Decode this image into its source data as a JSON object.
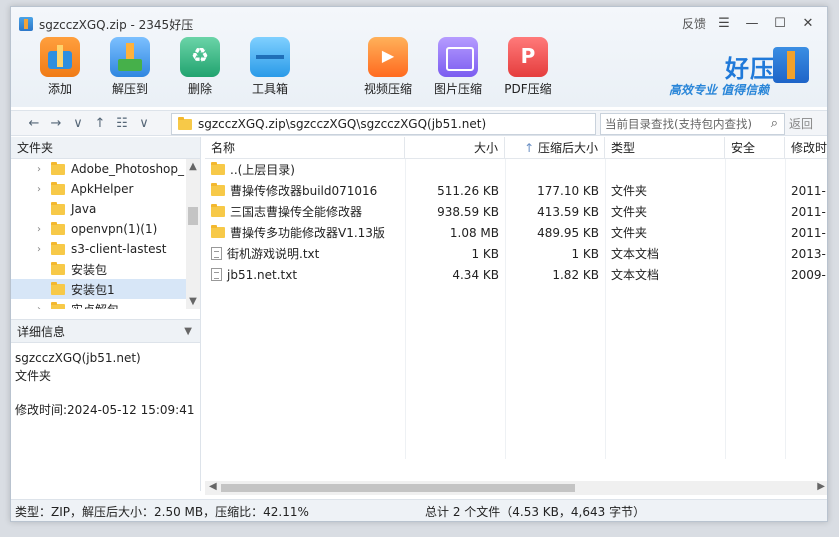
{
  "window": {
    "title": "sgzcczXGQ.zip - 2345好压",
    "feedback": "反馈"
  },
  "toolbar": [
    {
      "id": "add",
      "label": "添加",
      "icon": "add-icon"
    },
    {
      "id": "extract",
      "label": "解压到",
      "icon": "extract-icon"
    },
    {
      "id": "delete",
      "label": "删除",
      "icon": "recycle-icon"
    },
    {
      "id": "toolbox",
      "label": "工具箱",
      "icon": "toolbox-icon"
    },
    {
      "id": "video",
      "label": "视频压缩",
      "icon": "video-compress-icon"
    },
    {
      "id": "image",
      "label": "图片压缩",
      "icon": "image-compress-icon"
    },
    {
      "id": "pdf",
      "label": "PDF压缩",
      "icon": "pdf-compress-icon"
    }
  ],
  "brand": {
    "name": "好压",
    "slogan": "高效专业 值得信赖"
  },
  "address": {
    "path": "sgzcczXGQ.zip\\sgzcczXGQ\\sgzcczXGQ(jb51.net)",
    "search_placeholder": "当前目录查找(支持包内查找)",
    "back_label": "返回"
  },
  "left_pane": {
    "header": "文件夹",
    "tree": [
      {
        "label": "Adobe_Photoshop_",
        "expandable": true
      },
      {
        "label": "ApkHelper",
        "expandable": true
      },
      {
        "label": "Java",
        "expandable": false
      },
      {
        "label": "openvpn(1)(1)",
        "expandable": true
      },
      {
        "label": "s3-client-lastest",
        "expandable": true
      },
      {
        "label": "安装包",
        "expandable": false
      },
      {
        "label": "安装包1",
        "expandable": false,
        "selected": true
      },
      {
        "label": "实点解包",
        "expandable": true
      }
    ],
    "detail_header": "详细信息",
    "detail": {
      "name": "sgzcczXGQ(jb51.net)",
      "kind": "文件夹",
      "modified_label": "修改时间:",
      "modified": "2024-05-12 15:09:41"
    }
  },
  "columns": {
    "name": "名称",
    "size": "大小",
    "packed": "压缩后大小",
    "type": "类型",
    "encrypted": "安全",
    "modified": "修改时"
  },
  "files": [
    {
      "name": "..(上层目录)",
      "size": "",
      "packed": "",
      "type": "",
      "modified": "",
      "kind": "folder"
    },
    {
      "name": "曹操传修改器build071016",
      "size": "511.26 KB",
      "packed": "177.10 KB",
      "type": "文件夹",
      "modified": "2011-",
      "kind": "folder"
    },
    {
      "name": "三国志曹操传全能修改器",
      "size": "938.59 KB",
      "packed": "413.59 KB",
      "type": "文件夹",
      "modified": "2011-",
      "kind": "folder"
    },
    {
      "name": "曹操传多功能修改器V1.13版",
      "size": "1.08 MB",
      "packed": "489.95 KB",
      "type": "文件夹",
      "modified": "2011-",
      "kind": "folder"
    },
    {
      "name": "街机游戏说明.txt",
      "size": "1 KB",
      "packed": "1 KB",
      "type": "文本文档",
      "modified": "2013-",
      "kind": "txt"
    },
    {
      "name": "jb51.net.txt",
      "size": "4.34 KB",
      "packed": "1.82 KB",
      "type": "文本文档",
      "modified": "2009-",
      "kind": "txt"
    }
  ],
  "status": {
    "left": "类型：ZIP，解压后大小：2.50 MB，压缩比：42.11%",
    "right": "总计 2 个文件（4.53 KB，4,643 字节）"
  }
}
